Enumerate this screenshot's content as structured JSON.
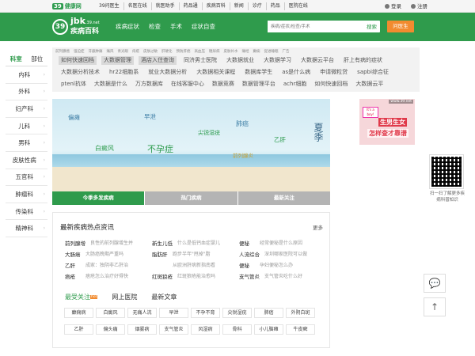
{
  "topbar": {
    "logo_num": "39",
    "logo_text": "健康网",
    "nav": [
      "39问医生",
      "名医在线",
      "就医助手",
      "药品通",
      "疾病百科",
      "新闻",
      "诊疗",
      "药品",
      "医院在线"
    ],
    "login": "登录",
    "register": "注册"
  },
  "header": {
    "brand_mark": "39",
    "brand_a": "jbk",
    "brand_site": ".39.net",
    "brand_b": "疾病百科",
    "nav": [
      "疾病症状",
      "检查",
      "手术",
      "症状自查"
    ],
    "search_placeholder": "疾病/症状/检查/手术",
    "search_label": "搜索",
    "ask_label": "问医生"
  },
  "sidebar": {
    "tabs": [
      "科室",
      "部位"
    ],
    "items": [
      "内科",
      "外科",
      "妇产科",
      "儿科",
      "男科",
      "皮肤性病",
      "五官科",
      "肿瘤科",
      "传染科",
      "精神科"
    ]
  },
  "tags": {
    "small": [
      "前列腺癌",
      "强迫症",
      "牙龈肿痛",
      "痛风",
      "青光眼",
      "痔疮",
      "皮肤过敏",
      "肝硬化",
      "预防肝癌",
      "高血压",
      "糖尿病",
      "皮肤补水",
      "痛经",
      "癫痫",
      "促进睡眠",
      "广告"
    ],
    "row1": [
      "如何快速回档",
      "大数据管理",
      "酒店入住查询",
      "同济男士医院",
      "大数据就业",
      "大数据学习",
      "大数据云平台",
      "肝上有病的症状"
    ],
    "row2": [
      "大数据分析技术",
      "hr22细胞系",
      "就业大数据分析",
      "大数据相关课程",
      "数据库学生",
      "as是什么病",
      "申请微粒贷",
      "sapbi综合征"
    ],
    "row3": [
      "ptenl抗体",
      "大数据是什么",
      "万方数据库",
      "在线客服中心",
      "数据竞赛",
      "数据管理平台",
      "achr细胞",
      "如何快速回档",
      "大数据云平"
    ]
  },
  "banner": {
    "words": [
      "偏瘫",
      "早泄",
      "尖锐湿疣",
      "肺癌",
      "白癜风",
      "不孕症",
      "乙肝",
      "前列腺炎"
    ],
    "summer": "夏季",
    "tabs": [
      "今季多发疾病",
      "热门疾病",
      "最新关注"
    ]
  },
  "ad": {
    "site": "www.39.net",
    "bubble": "It's a boy!",
    "line1": "生男生女",
    "line2": "怎样查才靠谱"
  },
  "qr": {
    "text": "扫一扫了解更多疾病科普知识"
  },
  "news": {
    "title": "最新疾病热点资讯",
    "more": "更多",
    "rows": [
      [
        {
          "k": "前列腺增",
          "v": "良性的前列腺增生并"
        },
        {
          "k": "新生儿低",
          "v": "什么是低钙血症婴儿"
        },
        {
          "k": "便秘",
          "v": "经常便秘是什么原因"
        }
      ],
      [
        {
          "k": "大肠癌",
          "v": "大肠癌晚期严重吗"
        },
        {
          "k": "脂肪肝",
          "v": "跑步半年\"甩掉\"脂"
        },
        {
          "k": "人流综合",
          "v": "深圳哪家医院可以做"
        }
      ],
      [
        {
          "k": "乙肝",
          "v": "成家：独阴非乙肝治"
        },
        {
          "k": "",
          "v": "从欧洲肝病新指南看"
        },
        {
          "k": "便秘",
          "v": "孕妇便秘怎么办"
        }
      ],
      [
        {
          "k": "痞疮",
          "v": "痞疮怎么治疗好得快"
        },
        {
          "k": "红斑狼疮",
          "v": "红斑狼疮能治愈吗"
        },
        {
          "k": "支气管炎",
          "v": "支气管炎吃什么好"
        }
      ]
    ],
    "subtabs": [
      "最受关注",
      "网上医院",
      "最新文章"
    ],
    "hot_badge": "hot",
    "kw_row1": [
      "癫痫病",
      "白癜风",
      "无痛人流",
      "早泄",
      "不孕不育",
      "尖锐湿疣",
      "肺癌",
      "外阴白斑"
    ],
    "kw_row2": [
      "乙肝",
      "偏头痛",
      "烟雾病",
      "支气管炎",
      "风湿病",
      "骨科",
      "小儿脑瘫",
      "牛皮癣"
    ]
  },
  "float": {
    "chat_icon": "💬",
    "top_icon": "↑"
  }
}
